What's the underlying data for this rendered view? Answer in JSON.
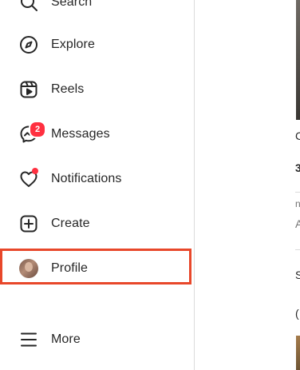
{
  "sidebar": {
    "items": [
      {
        "label": "Search",
        "icon": "search-icon"
      },
      {
        "label": "Explore",
        "icon": "compass-icon"
      },
      {
        "label": "Reels",
        "icon": "reels-icon"
      },
      {
        "label": "Messages",
        "icon": "messenger-icon",
        "badge": "2"
      },
      {
        "label": "Notifications",
        "icon": "heart-icon"
      },
      {
        "label": "Create",
        "icon": "plus-square-icon"
      },
      {
        "label": "Profile",
        "icon": "avatar"
      },
      {
        "label": "More",
        "icon": "menu-icon"
      }
    ]
  },
  "feed": {
    "glyphs": [
      "C",
      "3",
      "n",
      "A",
      "S",
      "("
    ]
  },
  "colors": {
    "badge": "#ff3040",
    "highlight_border": "#e8472a",
    "divider": "#dbdbdb",
    "text": "#262626"
  }
}
